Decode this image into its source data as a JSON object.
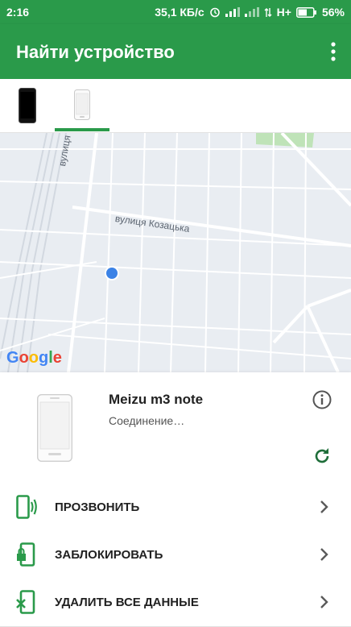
{
  "status_bar": {
    "time": "2:16",
    "speed": "35,1 КБ/с",
    "network": "H+",
    "battery": "56%"
  },
  "app_bar": {
    "title": "Найти устройство",
    "menu_icon": "more-vert-icon"
  },
  "tabs": [
    {
      "name": "phone-black",
      "selected": false
    },
    {
      "name": "phone-white",
      "selected": true
    }
  ],
  "map": {
    "labels": [
      "вулиця Гоголя",
      "вулиця Козацька"
    ],
    "logo": "Google"
  },
  "device": {
    "name": "Meizu m3 note",
    "status": "Соединение…",
    "info_icon": "info-icon",
    "refresh_icon": "refresh-icon"
  },
  "actions": [
    {
      "label": "ПРОЗВОНИТЬ",
      "icon": "ring-phone-icon"
    },
    {
      "label": "ЗАБЛОКИРОВАТЬ",
      "icon": "lock-phone-icon"
    },
    {
      "label": "УДАЛИТЬ ВСЕ ДАННЫЕ",
      "icon": "erase-phone-icon"
    }
  ],
  "colors": {
    "primary": "#2a9a4a",
    "location_dot": "#3b82e6",
    "map_bg": "#e9edf2"
  }
}
